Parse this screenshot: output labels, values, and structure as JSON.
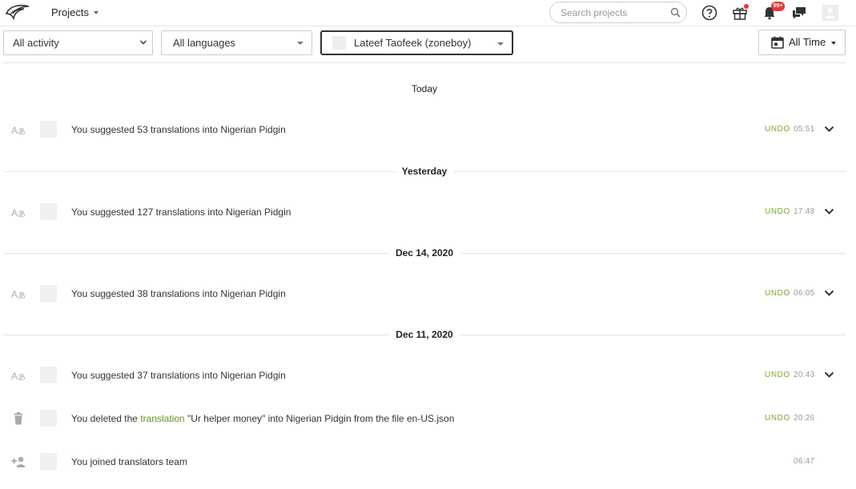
{
  "topbar": {
    "projects_label": "Projects",
    "search_placeholder": "Search projects",
    "notifications_badge": "99+"
  },
  "filters": {
    "activity_value": "All activity",
    "languages_value": "All languages",
    "user_value": "Lateef Taofeek (zoneboy)",
    "time_value": "All Time"
  },
  "groups": [
    {
      "date": "Today"
    },
    {
      "date": "Yesterday"
    },
    {
      "date": "Dec 14, 2020"
    },
    {
      "date": "Dec 11, 2020"
    }
  ],
  "activities": [
    {
      "icon": "translate-icon",
      "text": "You suggested 53 translations into Nigerian Pidgin",
      "undo": "UNDO",
      "time": "05:51"
    },
    {
      "icon": "translate-icon",
      "text": "You suggested 127 translations into Nigerian Pidgin",
      "undo": "UNDO",
      "time": "17:48"
    },
    {
      "icon": "translate-icon",
      "text": "You suggested 38 translations into Nigerian Pidgin",
      "undo": "UNDO",
      "time": "06:05"
    },
    {
      "icon": "translate-icon",
      "text": "You suggested 37 translations into Nigerian Pidgin",
      "undo": "UNDO",
      "time": "20:43"
    },
    {
      "icon": "trash-icon",
      "text_before": "You deleted the ",
      "link": "translation",
      "text_after": " \"Ur helper money\" into Nigerian Pidgin from the file en-US.json",
      "undo": "UNDO",
      "time": "20:26"
    },
    {
      "icon": "add-user-icon",
      "text": "You joined translators team",
      "time": "06:47"
    }
  ],
  "colors": {
    "accent_green": "#7ea42f",
    "link_green": "#6b8e23",
    "badge_red": "#e53935"
  }
}
